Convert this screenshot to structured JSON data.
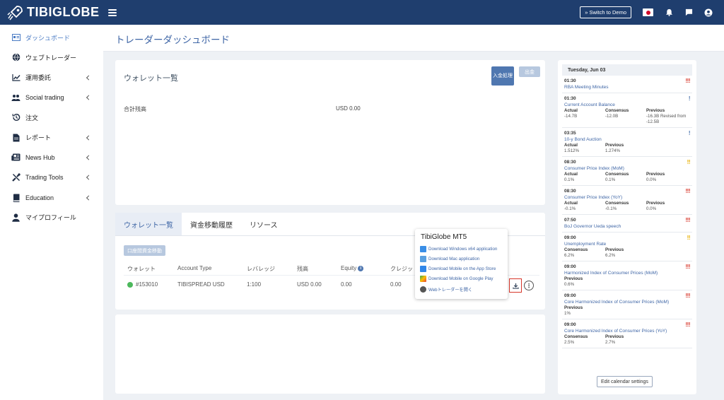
{
  "brand": {
    "name": "TIBIGLOBE"
  },
  "topbar": {
    "switch_label": "» Switch to Demo"
  },
  "sidebar": {
    "items": [
      {
        "label": "ダッシュボード",
        "icon": "dashboard-icon",
        "active": true,
        "chevron": false
      },
      {
        "label": "ウェブトレーダー",
        "icon": "globe-icon",
        "active": false,
        "chevron": false
      },
      {
        "label": "運用委託",
        "icon": "chart-line-icon",
        "active": false,
        "chevron": true
      },
      {
        "label": "Social trading",
        "icon": "users-icon",
        "active": false,
        "chevron": true
      },
      {
        "label": "注文",
        "icon": "history-icon",
        "active": false,
        "chevron": false
      },
      {
        "label": "レポート",
        "icon": "report-icon",
        "active": false,
        "chevron": true
      },
      {
        "label": "News Hub",
        "icon": "newspaper-icon",
        "active": false,
        "chevron": true
      },
      {
        "label": "Trading Tools",
        "icon": "tools-icon",
        "active": false,
        "chevron": true
      },
      {
        "label": "Education",
        "icon": "book-icon",
        "active": false,
        "chevron": true
      },
      {
        "label": "マイプロフィール",
        "icon": "user-icon",
        "active": false,
        "chevron": false
      }
    ]
  },
  "page": {
    "title": "トレーダーダッシュボード"
  },
  "wallet": {
    "title": "ウォレット一覧",
    "deposit_label": "入金処理",
    "withdraw_label": "出金",
    "balance_label": "合計残高",
    "balance_value": "USD 0.00"
  },
  "tabs": {
    "items": [
      "ウォレット一覧",
      "資金移動履歴",
      "リソース"
    ],
    "transfer_label": "口座間資金移動",
    "headers": [
      "ウォレット",
      "Account Type",
      "レバレッジ",
      "残高",
      "Equity",
      "クレジッ"
    ],
    "rows": [
      {
        "wallet": "#153010",
        "account_type": "TIBISPREAD USD",
        "leverage": "1:100",
        "balance": "USD 0.00",
        "equity": "0.00",
        "credit": "0.00"
      }
    ]
  },
  "popup": {
    "title": "TibiGlobe MT5",
    "items": [
      {
        "label": "Download Windows x64 application",
        "icon": "windows-icon",
        "color": "#3a8ee6"
      },
      {
        "label": "Download Mac application",
        "icon": "mac-icon",
        "color": "#5aa0e0"
      },
      {
        "label": "Download Mobile on the App Store",
        "icon": "app-store-icon",
        "color": "#2f86e8"
      },
      {
        "label": "Download Mobile on Google Play",
        "icon": "google-play-icon",
        "color": "#34a853"
      },
      {
        "label": "Webトレーダーを開く",
        "icon": "web-icon",
        "color": "#555555"
      }
    ]
  },
  "calendar": {
    "date": "Tuesday, Jun 03",
    "button_label": "Edit calendar settings",
    "events": [
      {
        "time": "01:30",
        "title": "RBA Meeting Minutes",
        "importance": "!!!",
        "level": "high",
        "cols": []
      },
      {
        "time": "01:30",
        "title": "Current Account Balance",
        "importance": "!",
        "level": "low",
        "cols": [
          {
            "k": "Actual",
            "v": "-14.7B"
          },
          {
            "k": "Consensus",
            "v": "-12.0B"
          },
          {
            "k": "Previous",
            "v": "-16.3B Revised from -12.5B"
          }
        ]
      },
      {
        "time": "03:35",
        "title": "10-y Bond Auction",
        "importance": "!",
        "level": "low",
        "cols": [
          {
            "k": "Actual",
            "v": "1.512%"
          },
          {
            "k": "Previous",
            "v": "1.274%"
          }
        ]
      },
      {
        "time": "08:30",
        "title": "Consumer Price Index (MoM)",
        "importance": "!!",
        "level": "med",
        "cols": [
          {
            "k": "Actual",
            "v": "0.1%"
          },
          {
            "k": "Consensus",
            "v": "0.1%"
          },
          {
            "k": "Previous",
            "v": "0.0%"
          }
        ]
      },
      {
        "time": "08:30",
        "title": "Consumer Price Index (YoY)",
        "importance": "!!!",
        "level": "high",
        "cols": [
          {
            "k": "Actual",
            "v": "-0.1%"
          },
          {
            "k": "Consensus",
            "v": "-0.1%"
          },
          {
            "k": "Previous",
            "v": "0.0%"
          }
        ]
      },
      {
        "time": "07:50",
        "title": "BoJ Governor Ueda speech",
        "importance": "!!!",
        "level": "high",
        "cols": []
      },
      {
        "time": "09:00",
        "title": "Unemployment Rate",
        "importance": "!!",
        "level": "med",
        "cols": [
          {
            "k": "Consensus",
            "v": "6.2%"
          },
          {
            "k": "Previous",
            "v": "6.2%"
          }
        ]
      },
      {
        "time": "09:00",
        "title": "Harmonized Index of Consumer Prices (MoM)",
        "importance": "!!!",
        "level": "high",
        "cols": [
          {
            "k": "Previous",
            "v": "0.6%"
          }
        ]
      },
      {
        "time": "09:00",
        "title": "Core Harmonized Index of Consumer Prices (MoM)",
        "importance": "!!!",
        "level": "high",
        "cols": [
          {
            "k": "Previous",
            "v": "1%"
          }
        ]
      },
      {
        "time": "09:00",
        "title": "Core Harmonized Index of Consumer Prices (YoY)",
        "importance": "!!!",
        "level": "high",
        "cols": [
          {
            "k": "Consensus",
            "v": "2.5%"
          },
          {
            "k": "Previous",
            "v": "2.7%"
          }
        ]
      }
    ]
  }
}
